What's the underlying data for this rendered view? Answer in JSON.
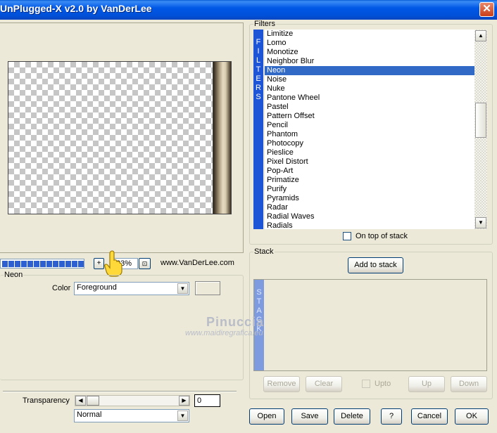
{
  "window": {
    "title": "UnPlugged-X v2.0 by VanDerLee",
    "close_glyph": "✕"
  },
  "preview": {
    "progress_segments": 13
  },
  "zoom": {
    "plus_label": "+",
    "value": "33%",
    "fit_glyph": "⊡"
  },
  "link": {
    "text": "www.VanDerLee.com"
  },
  "neon_panel": {
    "legend": "Neon",
    "color_label": "Color",
    "color_value": "Foreground",
    "transparency_label": "Transparency",
    "transparency_value": "0",
    "blend_value": "Normal"
  },
  "filters": {
    "legend": "Filters",
    "sidebar_letters": [
      "F",
      "I",
      "L",
      "T",
      "E",
      "R",
      "S"
    ],
    "items": [
      "Limitize",
      "Lomo",
      "Monotize",
      "Neighbor Blur",
      "Neon",
      "Noise",
      "Nuke",
      "Pantone Wheel",
      "Pastel",
      "Pattern Offset",
      "Pencil",
      "Phantom",
      "Photocopy",
      "Pieslice",
      "Pixel Distort",
      "Pop-Art",
      "Primatize",
      "Purify",
      "Pyramids",
      "Radar",
      "Radial Waves",
      "Radials"
    ],
    "selected": "Neon",
    "on_top_label": "On top of stack"
  },
  "stack": {
    "legend": "Stack",
    "add_label": "Add to stack",
    "sidebar_letters": [
      "S",
      "T",
      "A",
      "C",
      "K"
    ],
    "remove_label": "Remove",
    "clear_label": "Clear",
    "upto_label": "Upto",
    "up_label": "Up",
    "down_label": "Down"
  },
  "footer": {
    "open_label": "Open",
    "save_label": "Save",
    "delete_label": "Delete",
    "help_label": "?",
    "cancel_label": "Cancel",
    "ok_label": "OK"
  },
  "watermark": {
    "title": "Pinuccia",
    "url": "www.maidiregrafica.eu"
  },
  "colors": {
    "title_bar": "#0058e6",
    "selection": "#3169c6",
    "filters_sidebar": "#1e55d6",
    "stack_sidebar": "#7f9be0"
  }
}
